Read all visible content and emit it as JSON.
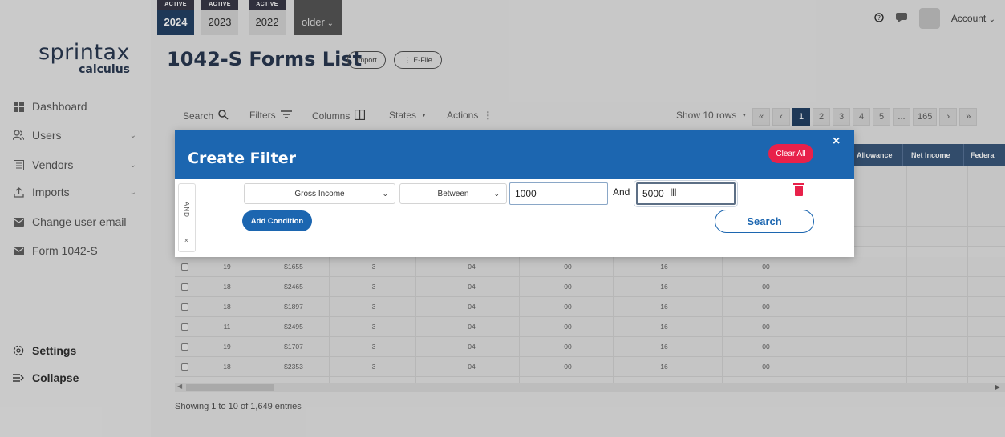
{
  "years": {
    "badge": "ACTIVE",
    "items": [
      {
        "label": "2024",
        "active": true,
        "badge": true
      },
      {
        "label": "2023",
        "active": false,
        "badge": true
      },
      {
        "label": "2022",
        "active": false,
        "badge": true
      },
      {
        "label": "older",
        "active": false,
        "badge": false
      }
    ]
  },
  "logo": {
    "main": "sprintax",
    "sub": "calculus"
  },
  "sidebar": {
    "items": [
      {
        "label": "Dashboard",
        "icon": "dashboard-icon"
      },
      {
        "label": "Users",
        "icon": "users-icon"
      },
      {
        "label": "Vendors",
        "icon": "vendors-icon"
      },
      {
        "label": "Imports",
        "icon": "upload-icon"
      },
      {
        "label": "Change user email",
        "icon": "mail-icon"
      },
      {
        "label": "Form 1042-S",
        "icon": "mail-icon"
      }
    ],
    "settings": "Settings",
    "collapse": "Collapse"
  },
  "header": {
    "title": "1042-S Forms List",
    "import_label": "Import",
    "efile_label": "E-File",
    "account_label": "Account"
  },
  "toolbar": {
    "search": "Search",
    "filters": "Filters",
    "columns": "Columns",
    "states": "States",
    "actions": "Actions",
    "show_rows": "Show 10 rows"
  },
  "pager": {
    "pages": [
      "«",
      "‹",
      "1",
      "2",
      "3",
      "4",
      "5",
      "...",
      "165",
      "›",
      "»"
    ],
    "current": "1"
  },
  "table": {
    "visible_headers": [
      "Allowance",
      "Net Income",
      "Federa"
    ],
    "rows": [
      [
        "19",
        "$1655",
        "3",
        "04",
        "00",
        "16",
        "00"
      ],
      [
        "18",
        "$2465",
        "3",
        "04",
        "00",
        "16",
        "00"
      ],
      [
        "18",
        "$1897",
        "3",
        "04",
        "00",
        "16",
        "00"
      ],
      [
        "11",
        "$2495",
        "3",
        "04",
        "00",
        "16",
        "00"
      ],
      [
        "19",
        "$1707",
        "3",
        "04",
        "00",
        "16",
        "00"
      ],
      [
        "18",
        "$2353",
        "3",
        "04",
        "00",
        "16",
        "00"
      ]
    ],
    "entries_text": "Showing 1 to 10 of 1,649 entries"
  },
  "modal": {
    "title": "Create Filter",
    "clear_all": "Clear All",
    "close": "×",
    "conjunction": "AND",
    "remove_group": "×",
    "field": "Gross Income",
    "operator": "Between",
    "value_from": "1000",
    "and_label": "And",
    "value_to": "5000",
    "add_condition": "Add Condition",
    "search": "Search"
  },
  "colors": {
    "brand_blue": "#1c66b0",
    "navy": "#14345a",
    "danger": "#e8214a"
  }
}
